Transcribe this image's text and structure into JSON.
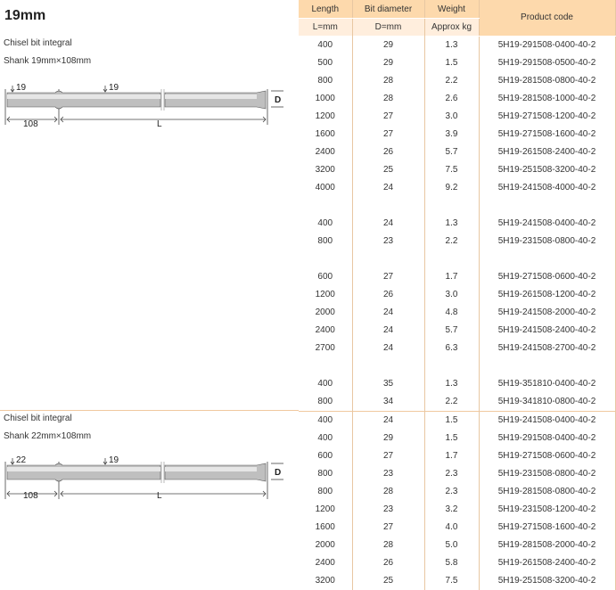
{
  "title": "19mm",
  "headers": {
    "length": "Length",
    "bit_diameter": "Bit diameter",
    "weight": "Weight",
    "product_code": "Product code",
    "length_unit": "L=mm",
    "diameter_unit": "D=mm",
    "weight_unit": "Approx kg"
  },
  "sections": [
    {
      "name": "Chisel bit integral",
      "shank": "Shank  19mm×108mm",
      "drawing": {
        "shank_dia": "19",
        "body_dia": "19",
        "shank_len": "108",
        "length": "L",
        "diameter": "D"
      }
    },
    {
      "name": "Chisel bit integral",
      "shank": "Shank  22mm×108mm",
      "drawing": {
        "shank_dia": "22",
        "body_dia": "19",
        "shank_len": "108",
        "length": "L",
        "diameter": "D"
      }
    }
  ],
  "rows": [
    {
      "length": "400",
      "dia": "29",
      "weight": "1.3",
      "code": "5H19-291508-0400-40-2"
    },
    {
      "length": "500",
      "dia": "29",
      "weight": "1.5",
      "code": "5H19-291508-0500-40-2"
    },
    {
      "length": "800",
      "dia": "28",
      "weight": "2.2",
      "code": "5H19-281508-0800-40-2"
    },
    {
      "length": "1000",
      "dia": "28",
      "weight": "2.6",
      "code": "5H19-281508-1000-40-2"
    },
    {
      "length": "1200",
      "dia": "27",
      "weight": "3.0",
      "code": "5H19-271508-1200-40-2"
    },
    {
      "length": "1600",
      "dia": "27",
      "weight": "3.9",
      "code": "5H19-271508-1600-40-2"
    },
    {
      "length": "2400",
      "dia": "26",
      "weight": "5.7",
      "code": "5H19-261508-2400-40-2"
    },
    {
      "length": "3200",
      "dia": "25",
      "weight": "7.5",
      "code": "5H19-251508-3200-40-2"
    },
    {
      "length": "4000",
      "dia": "24",
      "weight": "9.2",
      "code": "5H19-241508-4000-40-2"
    },
    {
      "length": "",
      "dia": "",
      "weight": "",
      "code": ""
    },
    {
      "length": "400",
      "dia": "24",
      "weight": "1.3",
      "code": "5H19-241508-0400-40-2"
    },
    {
      "length": "800",
      "dia": "23",
      "weight": "2.2",
      "code": "5H19-231508-0800-40-2"
    },
    {
      "length": "",
      "dia": "",
      "weight": "",
      "code": ""
    },
    {
      "length": "600",
      "dia": "27",
      "weight": "1.7",
      "code": "5H19-271508-0600-40-2"
    },
    {
      "length": "1200",
      "dia": "26",
      "weight": "3.0",
      "code": "5H19-261508-1200-40-2"
    },
    {
      "length": "2000",
      "dia": "24",
      "weight": "4.8",
      "code": "5H19-241508-2000-40-2"
    },
    {
      "length": "2400",
      "dia": "24",
      "weight": "5.7",
      "code": "5H19-241508-2400-40-2"
    },
    {
      "length": "2700",
      "dia": "24",
      "weight": "6.3",
      "code": "5H19-241508-2700-40-2"
    },
    {
      "length": "",
      "dia": "",
      "weight": "",
      "code": ""
    },
    {
      "length": "400",
      "dia": "35",
      "weight": "1.3",
      "code": "5H19-351810-0400-40-2"
    },
    {
      "length": "800",
      "dia": "34",
      "weight": "2.2",
      "code": "5H19-341810-0800-40-2"
    },
    {
      "length": "400",
      "dia": "24",
      "weight": "1.5",
      "code": "5H19-241508-0400-40-2"
    },
    {
      "length": "400",
      "dia": "29",
      "weight": "1.5",
      "code": "5H19-291508-0400-40-2"
    },
    {
      "length": "600",
      "dia": "27",
      "weight": "1.7",
      "code": "5H19-271508-0600-40-2"
    },
    {
      "length": "800",
      "dia": "23",
      "weight": "2.3",
      "code": "5H19-231508-0800-40-2"
    },
    {
      "length": "800",
      "dia": "28",
      "weight": "2.3",
      "code": "5H19-281508-0800-40-2"
    },
    {
      "length": "1200",
      "dia": "23",
      "weight": "3.2",
      "code": "5H19-231508-1200-40-2"
    },
    {
      "length": "1600",
      "dia": "27",
      "weight": "4.0",
      "code": "5H19-271508-1600-40-2"
    },
    {
      "length": "2000",
      "dia": "28",
      "weight": "5.0",
      "code": "5H19-281508-2000-40-2"
    },
    {
      "length": "2400",
      "dia": "26",
      "weight": "5.8",
      "code": "5H19-261508-2400-40-2"
    },
    {
      "length": "3200",
      "dia": "25",
      "weight": "7.5",
      "code": "5H19-251508-3200-40-2"
    }
  ],
  "colors": {
    "header_bg": "#fdd9ac",
    "subheader_bg": "#ffeedd",
    "separator": "#f0c9a0"
  }
}
